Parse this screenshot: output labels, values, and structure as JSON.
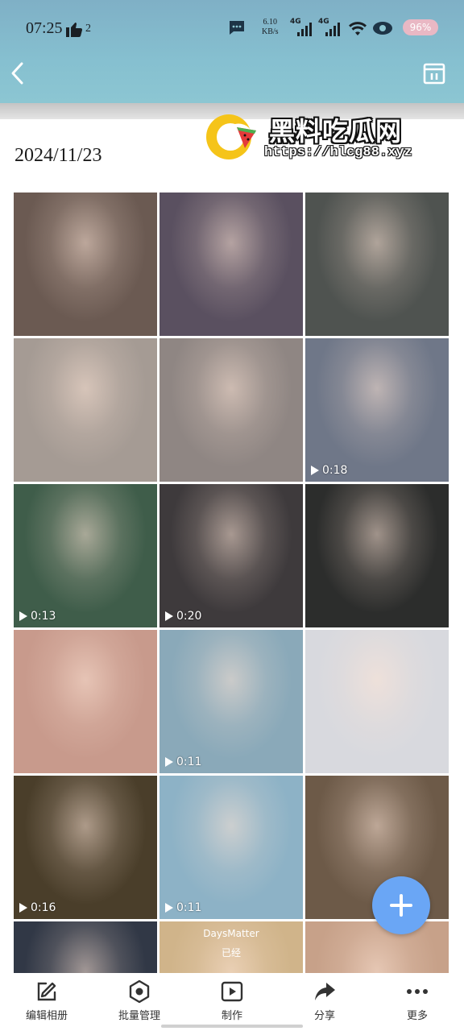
{
  "status": {
    "time": "07:25",
    "likes": "2",
    "net_speed_value": "6.10",
    "net_speed_unit": "KB/s",
    "signal1": "4G",
    "signal2": "4G",
    "battery": "96%"
  },
  "watermark": {
    "title": "黑料吃瓜网",
    "url": "https://hlcg88.xyz"
  },
  "album": {
    "date": "2024/11/23",
    "tiles": [
      {
        "type": "photo",
        "duration": "",
        "bg": "#6b5a52"
      },
      {
        "type": "photo",
        "duration": "",
        "bg": "#5a5060"
      },
      {
        "type": "photo",
        "duration": "",
        "bg": "#4f5350"
      },
      {
        "type": "photo",
        "duration": "",
        "bg": "#a59b94"
      },
      {
        "type": "photo",
        "duration": "",
        "bg": "#8f8683"
      },
      {
        "type": "video",
        "duration": "0:18",
        "bg": "#6f7788"
      },
      {
        "type": "video",
        "duration": "0:13",
        "bg": "#3f5d4a"
      },
      {
        "type": "video",
        "duration": "0:20",
        "bg": "#3e3a3c"
      },
      {
        "type": "photo",
        "duration": "",
        "bg": "#2c2d2c"
      },
      {
        "type": "photo",
        "duration": "",
        "bg": "#c89a8c"
      },
      {
        "type": "video",
        "duration": "0:11",
        "bg": "#8aa9b9"
      },
      {
        "type": "photo",
        "duration": "",
        "bg": "#d8d9de"
      },
      {
        "type": "video",
        "duration": "0:16",
        "bg": "#4a3e2a"
      },
      {
        "type": "video",
        "duration": "0:11",
        "bg": "#8db2c6"
      },
      {
        "type": "photo",
        "duration": "",
        "bg": "#6d5a48"
      },
      {
        "type": "photo",
        "duration": "",
        "bg": "#313846"
      },
      {
        "type": "photo",
        "duration": "",
        "bg": "#d0b48a",
        "caption": "DaysMatter",
        "subcaption": "已经"
      },
      {
        "type": "photo",
        "duration": "",
        "bg": "#c7a189"
      }
    ]
  },
  "bottom_bar": {
    "items": [
      {
        "label": "编辑相册",
        "icon": "edit-icon"
      },
      {
        "label": "批量管理",
        "icon": "manage-icon"
      },
      {
        "label": "制作",
        "icon": "play-icon"
      },
      {
        "label": "分享",
        "icon": "share-icon"
      },
      {
        "label": "更多",
        "icon": "more-icon"
      }
    ]
  },
  "colors": {
    "header": "#86c0d0",
    "fab": "#6aa6f5"
  }
}
